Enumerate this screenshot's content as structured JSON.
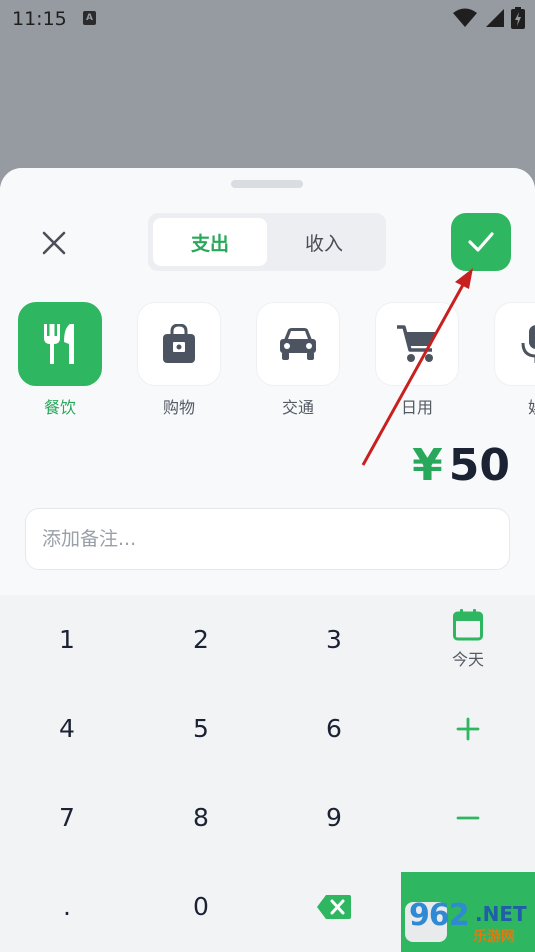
{
  "status_bar": {
    "time": "11:15",
    "notif_icon": "A",
    "icons": [
      "wifi-icon",
      "signal-icon",
      "battery-charging-icon"
    ]
  },
  "header": {
    "close_icon": "close-icon",
    "tabs": [
      {
        "label": "支出",
        "active": true
      },
      {
        "label": "收入",
        "active": false
      }
    ],
    "confirm_icon": "check-icon"
  },
  "categories": [
    {
      "label": "餐饮",
      "icon": "utensils-icon",
      "active": true
    },
    {
      "label": "购物",
      "icon": "shopping-bag-icon",
      "active": false
    },
    {
      "label": "交通",
      "icon": "car-icon",
      "active": false
    },
    {
      "label": "日用",
      "icon": "cart-icon",
      "active": false
    },
    {
      "label": "娱",
      "icon": "microphone-icon",
      "active": false
    }
  ],
  "amount": {
    "currency": "¥",
    "value": "50"
  },
  "note": {
    "placeholder": "添加备注..."
  },
  "keypad": {
    "keys": [
      "1",
      "2",
      "3",
      "4",
      "5",
      "6",
      "7",
      "8",
      "9",
      ".",
      "0"
    ],
    "today_label": "今天",
    "plus": "+",
    "minus": "−"
  },
  "watermark": {
    "number": "962",
    "net": ".NET",
    "sub": "乐游网"
  },
  "colors": {
    "accent": "#2eb660",
    "overlay": "#969aa1",
    "text_dark": "#1b2233",
    "arrow": "#c8201f"
  }
}
